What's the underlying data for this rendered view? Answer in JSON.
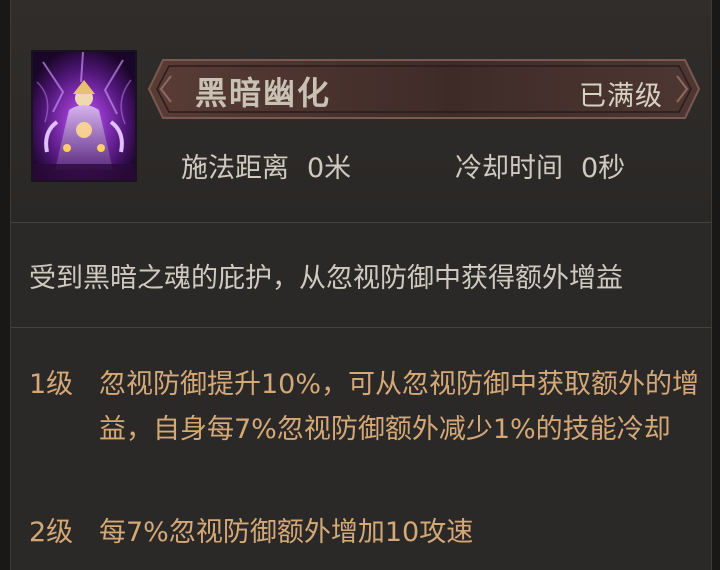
{
  "skill": {
    "name": "黑暗幽化",
    "level_status": "已满级",
    "icon": "dark-priestess-icon",
    "stats": {
      "range_label": "施法距离",
      "range_value": "0米",
      "cooldown_label": "冷却时间",
      "cooldown_value": "0秒"
    },
    "description": "受到黑暗之魂的庇护，从忽视防御中获得额外增益",
    "levels": [
      {
        "level": "1级",
        "text": "忽视防御提升10%，可从忽视防御中获取额外的增益，自身每7%忽视防御额外减少1%的技能冷却"
      },
      {
        "level": "2级",
        "text": "每7%忽视防御额外增加10攻速"
      }
    ]
  },
  "colors": {
    "panel_bg": "#2b2927",
    "text": "#cfcac0",
    "level_text": "#d4a877",
    "banner": "#4a3530"
  }
}
